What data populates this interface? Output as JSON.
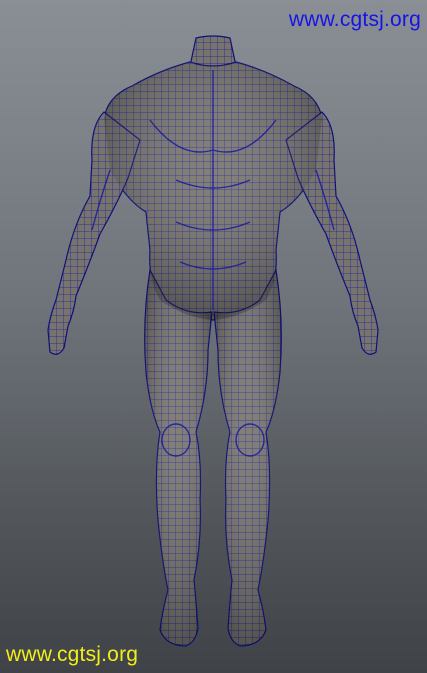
{
  "viewport": {
    "background_top": "#8a8f95",
    "background_bottom": "#3f4246"
  },
  "model": {
    "subject": "human-male-body-wireframe",
    "mesh_fill": "#77746d",
    "wire_color": "#1a1aa0",
    "outline_color": "#10107a"
  },
  "watermarks": {
    "top": {
      "text": "www.cgtsj.org",
      "color": "#1414e6"
    },
    "bottom": {
      "text": "www.cgtsj.org",
      "color": "#f2ee1a"
    }
  }
}
